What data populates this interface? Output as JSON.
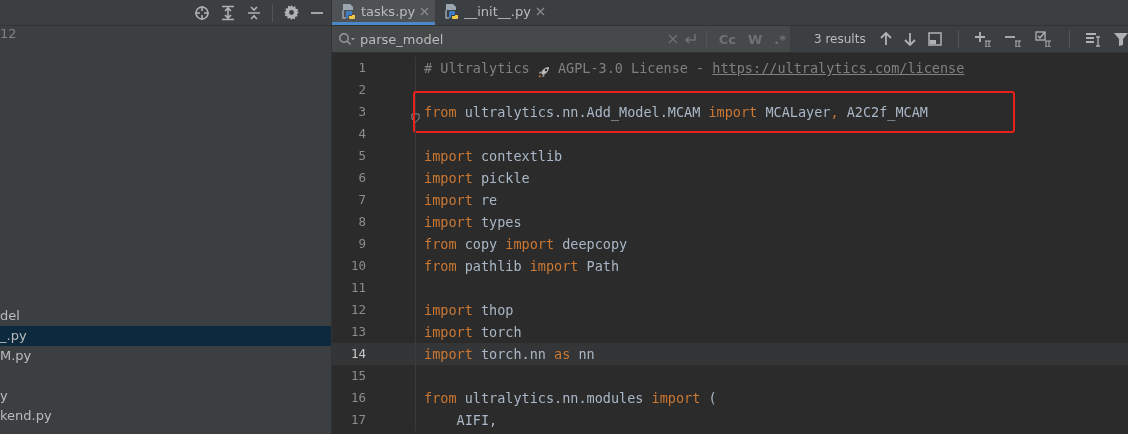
{
  "project_panel": {
    "toolbar": [
      {
        "kind": "locate"
      },
      {
        "kind": "expand"
      },
      {
        "kind": "collapse"
      },
      {
        "kind": "settings"
      },
      {
        "kind": "hide"
      }
    ],
    "header_text": "12",
    "items": [
      {
        "label": "del",
        "selected": false
      },
      {
        "label": "_.py",
        "selected": true
      },
      {
        "label": "M.py",
        "selected": false
      },
      {
        "selected": false
      },
      {
        "label": "y",
        "selected": false
      },
      {
        "label": "kend.py",
        "selected": false
      }
    ]
  },
  "tabs": [
    {
      "label": "tasks.py",
      "selected": true
    },
    {
      "label": "__init__.py",
      "selected": false
    }
  ],
  "find_bar": {
    "value": "parse_model",
    "options": [
      {
        "label": "Cc",
        "selected": false
      },
      {
        "label": "W",
        "selected": false
      },
      {
        "label": ".*",
        "selected": false
      }
    ],
    "results": "3 results"
  },
  "editor": {
    "lines": [
      {
        "number": "1",
        "highlighted": false,
        "current": false,
        "tokens": [
          {
            "kind": "comment",
            "text": "# Ultralytics "
          },
          {
            "kind": "rocket"
          },
          {
            "kind": "comment",
            "text": " AGPL-3.0 License - "
          },
          {
            "kind": "link",
            "text": "https://ultralytics.com/license"
          }
        ]
      },
      {
        "number": "2",
        "highlighted": false,
        "current": false
      },
      {
        "number": "3",
        "highlighted": true,
        "current": false,
        "tokens": [
          {
            "kind": "keyword",
            "text": "from"
          },
          {
            "kind": "plain",
            "text": " ultralytics.nn.Add_Model.MCAM "
          },
          {
            "kind": "keyword",
            "text": "import"
          },
          {
            "kind": "plain",
            "text": " MCALayer"
          },
          {
            "kind": "keyword",
            "text": ","
          },
          {
            "kind": "plain",
            "text": " A2C2f_MCAM"
          }
        ]
      },
      {
        "number": "4",
        "highlighted": false,
        "current": false
      },
      {
        "number": "5",
        "highlighted": false,
        "current": false,
        "tokens": [
          {
            "kind": "keyword",
            "text": "import"
          },
          {
            "kind": "plain",
            "text": " contextlib"
          }
        ]
      },
      {
        "number": "6",
        "highlighted": false,
        "current": false,
        "tokens": [
          {
            "kind": "keyword",
            "text": "import"
          },
          {
            "kind": "plain",
            "text": " pickle"
          }
        ]
      },
      {
        "number": "7",
        "highlighted": false,
        "current": false,
        "tokens": [
          {
            "kind": "keyword",
            "text": "import"
          },
          {
            "kind": "plain",
            "text": " re"
          }
        ]
      },
      {
        "number": "8",
        "highlighted": false,
        "current": false,
        "tokens": [
          {
            "kind": "keyword",
            "text": "import"
          },
          {
            "kind": "plain",
            "text": " types"
          }
        ]
      },
      {
        "number": "9",
        "highlighted": false,
        "current": false,
        "tokens": [
          {
            "kind": "keyword",
            "text": "from"
          },
          {
            "kind": "plain",
            "text": " copy "
          },
          {
            "kind": "keyword",
            "text": "import"
          },
          {
            "kind": "plain",
            "text": " deepcopy"
          }
        ]
      },
      {
        "number": "10",
        "highlighted": false,
        "current": false,
        "tokens": [
          {
            "kind": "keyword",
            "text": "from"
          },
          {
            "kind": "plain",
            "text": " pathlib "
          },
          {
            "kind": "keyword",
            "text": "import"
          },
          {
            "kind": "plain",
            "text": " Path"
          }
        ]
      },
      {
        "number": "11",
        "highlighted": false,
        "current": false
      },
      {
        "number": "12",
        "highlighted": false,
        "current": false,
        "tokens": [
          {
            "kind": "keyword",
            "text": "import"
          },
          {
            "kind": "plain",
            "text": " thop"
          }
        ]
      },
      {
        "number": "13",
        "highlighted": false,
        "current": false,
        "tokens": [
          {
            "kind": "keyword",
            "text": "import"
          },
          {
            "kind": "plain",
            "text": " torch"
          }
        ]
      },
      {
        "number": "14",
        "highlighted": false,
        "current": true,
        "tokens": [
          {
            "kind": "keyword",
            "text": "import"
          },
          {
            "kind": "plain",
            "text": " torch.nn "
          },
          {
            "kind": "keyword",
            "text": "as"
          },
          {
            "kind": "plain",
            "text": " nn"
          }
        ]
      },
      {
        "number": "15",
        "highlighted": false,
        "current": false
      },
      {
        "number": "16",
        "highlighted": false,
        "current": false,
        "tokens": [
          {
            "kind": "keyword",
            "text": "from"
          },
          {
            "kind": "plain",
            "text": " ultralytics.nn.modules "
          },
          {
            "kind": "keyword",
            "text": "import"
          },
          {
            "kind": "plain",
            "text": " ("
          }
        ]
      },
      {
        "number": "17",
        "highlighted": false,
        "current": false,
        "tokens": [
          {
            "kind": "plain",
            "text": "    AIFI,"
          }
        ]
      }
    ]
  }
}
